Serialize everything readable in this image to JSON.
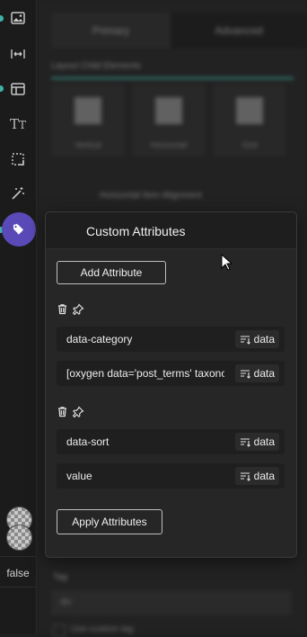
{
  "sidebar": {
    "toggle_value": "false",
    "icons": [
      "image-icon",
      "width-icon",
      "layout-icon",
      "typography-icon",
      "borders-icon",
      "effects-icon",
      "tag-icon"
    ]
  },
  "main": {
    "tabs": [
      {
        "label": "Primary"
      },
      {
        "label": "Advanced"
      }
    ],
    "layout_label": "Layout Child Elements",
    "layout_options": [
      {
        "label": "Vertical"
      },
      {
        "label": "Horizontal"
      },
      {
        "label": "Grid"
      }
    ],
    "horizontal_alignment_label": "Horizontal Item Alignment",
    "tag_label": "Tag",
    "tag_value": "div",
    "custom_tag_label": "Use custom tag"
  },
  "popover": {
    "title": "Custom Attributes",
    "add_button": "Add Attribute",
    "apply_button": "Apply Attributes",
    "attributes": [
      {
        "name": "data-category",
        "value": "[oxygen data='post_terms' taxonomy='category']",
        "name_data_label": "data",
        "value_data_label": "data"
      },
      {
        "name": "data-sort",
        "value": "value",
        "name_data_label": "data",
        "value_data_label": "data"
      }
    ]
  },
  "colors": {
    "accent": "#3fb1a7",
    "active_icon_bg": "#5a4ab8"
  }
}
